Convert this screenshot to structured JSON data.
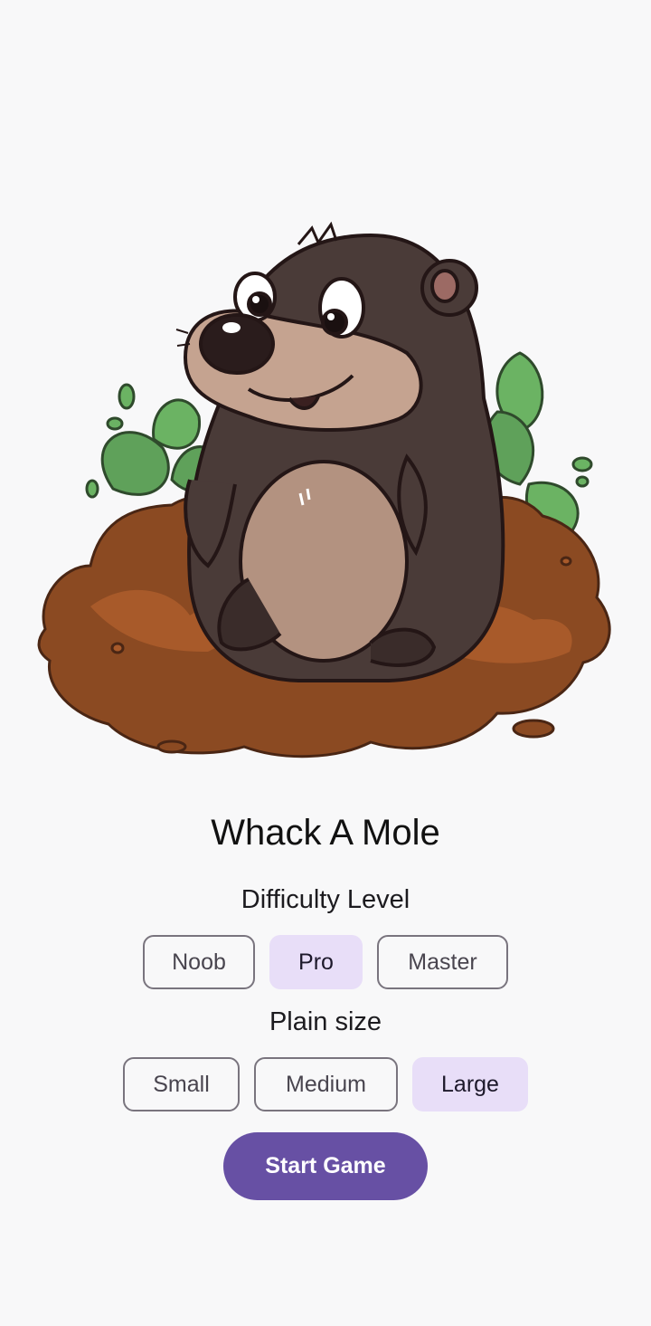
{
  "app": {
    "title": "Whack A Mole"
  },
  "hero": {
    "image": "mole-in-dirt-mound-illustration"
  },
  "difficulty": {
    "label": "Difficulty Level",
    "options": [
      "Noob",
      "Pro",
      "Master"
    ],
    "selected": "Pro"
  },
  "plain_size": {
    "label": "Plain size",
    "options": [
      "Small",
      "Medium",
      "Large"
    ],
    "selected": "Large"
  },
  "start_button": {
    "label": "Start Game"
  },
  "colors": {
    "background": "#f8f8f9",
    "primary": "#6750a4",
    "selected_chip": "#e8def8",
    "chip_outline": "#79747e"
  }
}
